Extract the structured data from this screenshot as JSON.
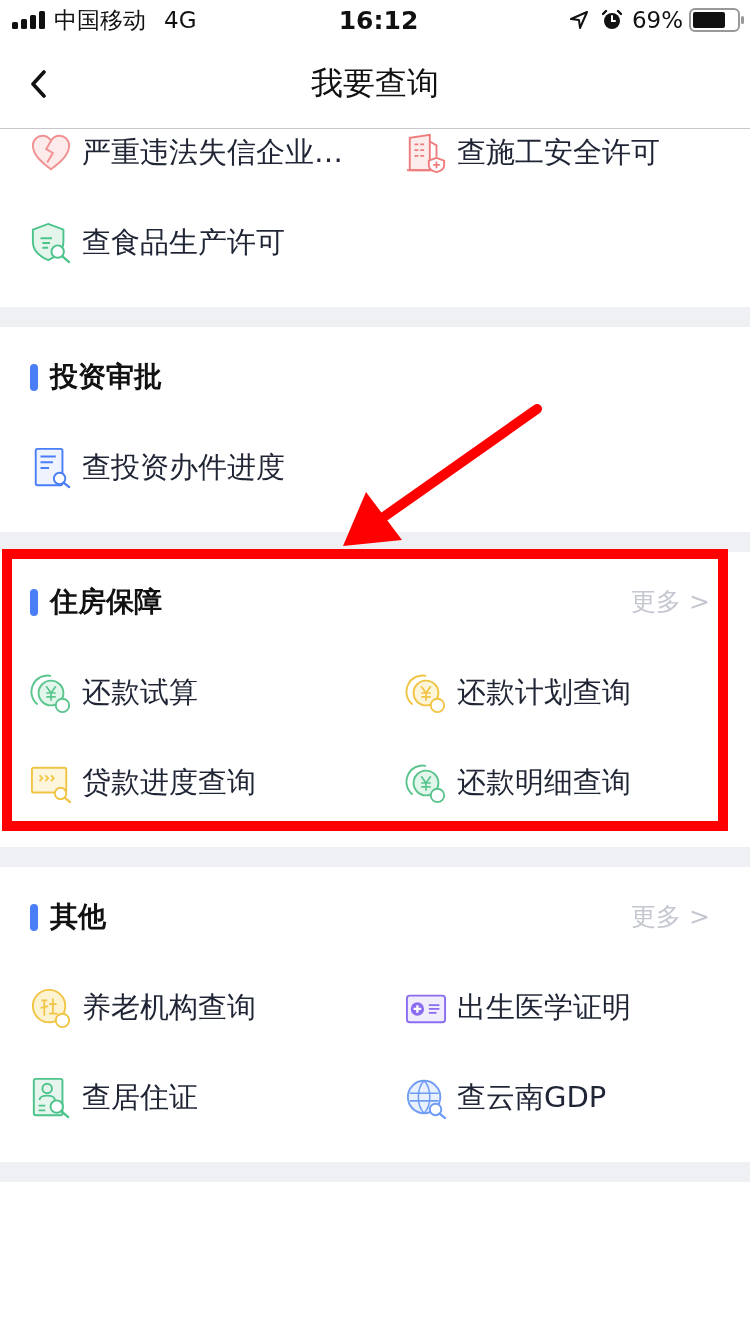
{
  "status_bar": {
    "carrier": "中国移动",
    "network": "4G",
    "time": "16:12",
    "battery": "69%"
  },
  "nav": {
    "title": "我要查询"
  },
  "sections": [
    {
      "highlighted": false,
      "items": [
        "严重违法失信企业…",
        "查施工安全许可",
        "查食品生产许可"
      ]
    },
    {
      "title": "投资审批",
      "highlighted": false,
      "items": [
        "查投资办件进度"
      ]
    },
    {
      "title": "住房保障",
      "more": "更多 >",
      "highlighted": true,
      "items": [
        "还款试算",
        "还款计划查询",
        "贷款进度查询",
        "还款明细查询"
      ]
    },
    {
      "title": "其他",
      "more": "更多 >",
      "highlighted": false,
      "items": [
        "养老机构查询",
        "出生医学证明",
        "查居住证",
        "查云南GDP"
      ]
    }
  ]
}
